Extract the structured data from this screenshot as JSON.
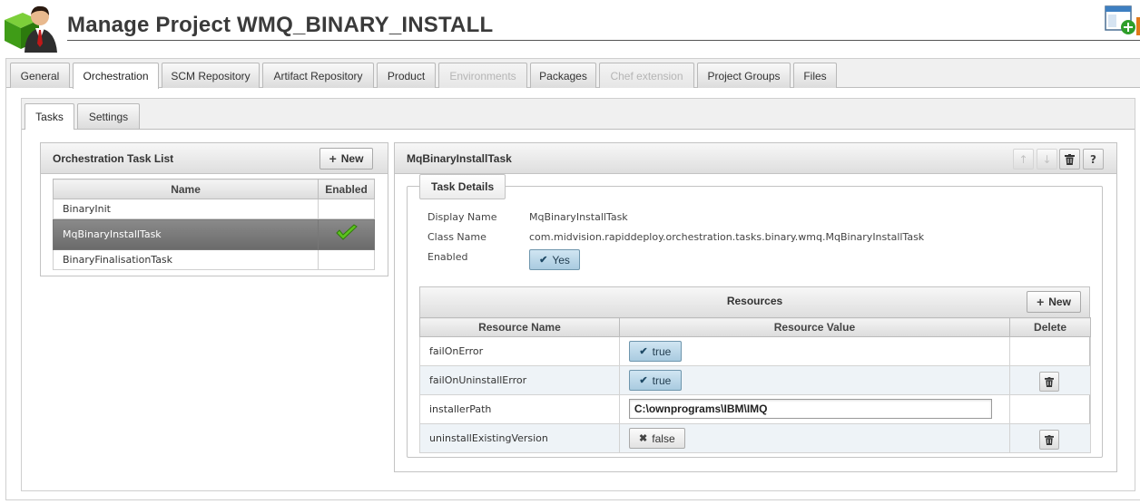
{
  "header": {
    "title": "Manage Project WMQ_BINARY_INSTALL",
    "logo_icon": "admin-user-cube-icon",
    "action_icon": "add-window-icon"
  },
  "main_tabs": [
    {
      "label": "General",
      "state": "normal"
    },
    {
      "label": "Orchestration",
      "state": "active"
    },
    {
      "label": "SCM Repository",
      "state": "normal"
    },
    {
      "label": "Artifact Repository",
      "state": "normal"
    },
    {
      "label": "Product",
      "state": "normal"
    },
    {
      "label": "Environments",
      "state": "disabled"
    },
    {
      "label": "Packages",
      "state": "normal"
    },
    {
      "label": "Chef extension",
      "state": "disabled"
    },
    {
      "label": "Project Groups",
      "state": "normal"
    },
    {
      "label": "Files",
      "state": "normal"
    }
  ],
  "sub_tabs": [
    {
      "label": "Tasks",
      "state": "active"
    },
    {
      "label": "Settings",
      "state": "normal"
    }
  ],
  "task_list": {
    "title": "Orchestration Task List",
    "new_label": "New",
    "columns": [
      "Name",
      "Enabled"
    ],
    "rows": [
      {
        "name": "BinaryInit",
        "enabled": false,
        "selected": false
      },
      {
        "name": "MqBinaryInstallTask",
        "enabled": true,
        "selected": true
      },
      {
        "name": "BinaryFinalisationTask",
        "enabled": false,
        "selected": false
      }
    ]
  },
  "task": {
    "title": "MqBinaryInstallTask",
    "toolbar_icons": [
      "arrow-up-icon",
      "arrow-down-icon",
      "trash-icon",
      "help-icon"
    ],
    "details": {
      "legend": "Task Details",
      "display_name_label": "Display Name",
      "display_name_value": "MqBinaryInstallTask",
      "class_name_label": "Class Name",
      "class_name_value": "com.midvision.rapiddeploy.orchestration.tasks.binary.wmq.MqBinaryInstallTask",
      "enabled_label": "Enabled",
      "enabled_value": "Yes"
    },
    "resources": {
      "title": "Resources",
      "new_label": "New",
      "columns": [
        "Resource Name",
        "Resource Value",
        "Delete"
      ],
      "rows": [
        {
          "name": "failOnError",
          "type": "toggle",
          "value": "true",
          "on": true,
          "deletable": false
        },
        {
          "name": "failOnUninstallError",
          "type": "toggle",
          "value": "true",
          "on": true,
          "deletable": true
        },
        {
          "name": "installerPath",
          "type": "text",
          "value": "C:\\ownprograms\\IBM\\IMQ",
          "deletable": false
        },
        {
          "name": "uninstallExistingVersion",
          "type": "toggle",
          "value": "false",
          "on": false,
          "deletable": true
        }
      ]
    }
  },
  "colors": {
    "selected_row": "#7a7a7a",
    "toggle_on": "#b8d6e8",
    "check_green": "#4caf1a",
    "disabled_text": "#b5b5b5"
  }
}
